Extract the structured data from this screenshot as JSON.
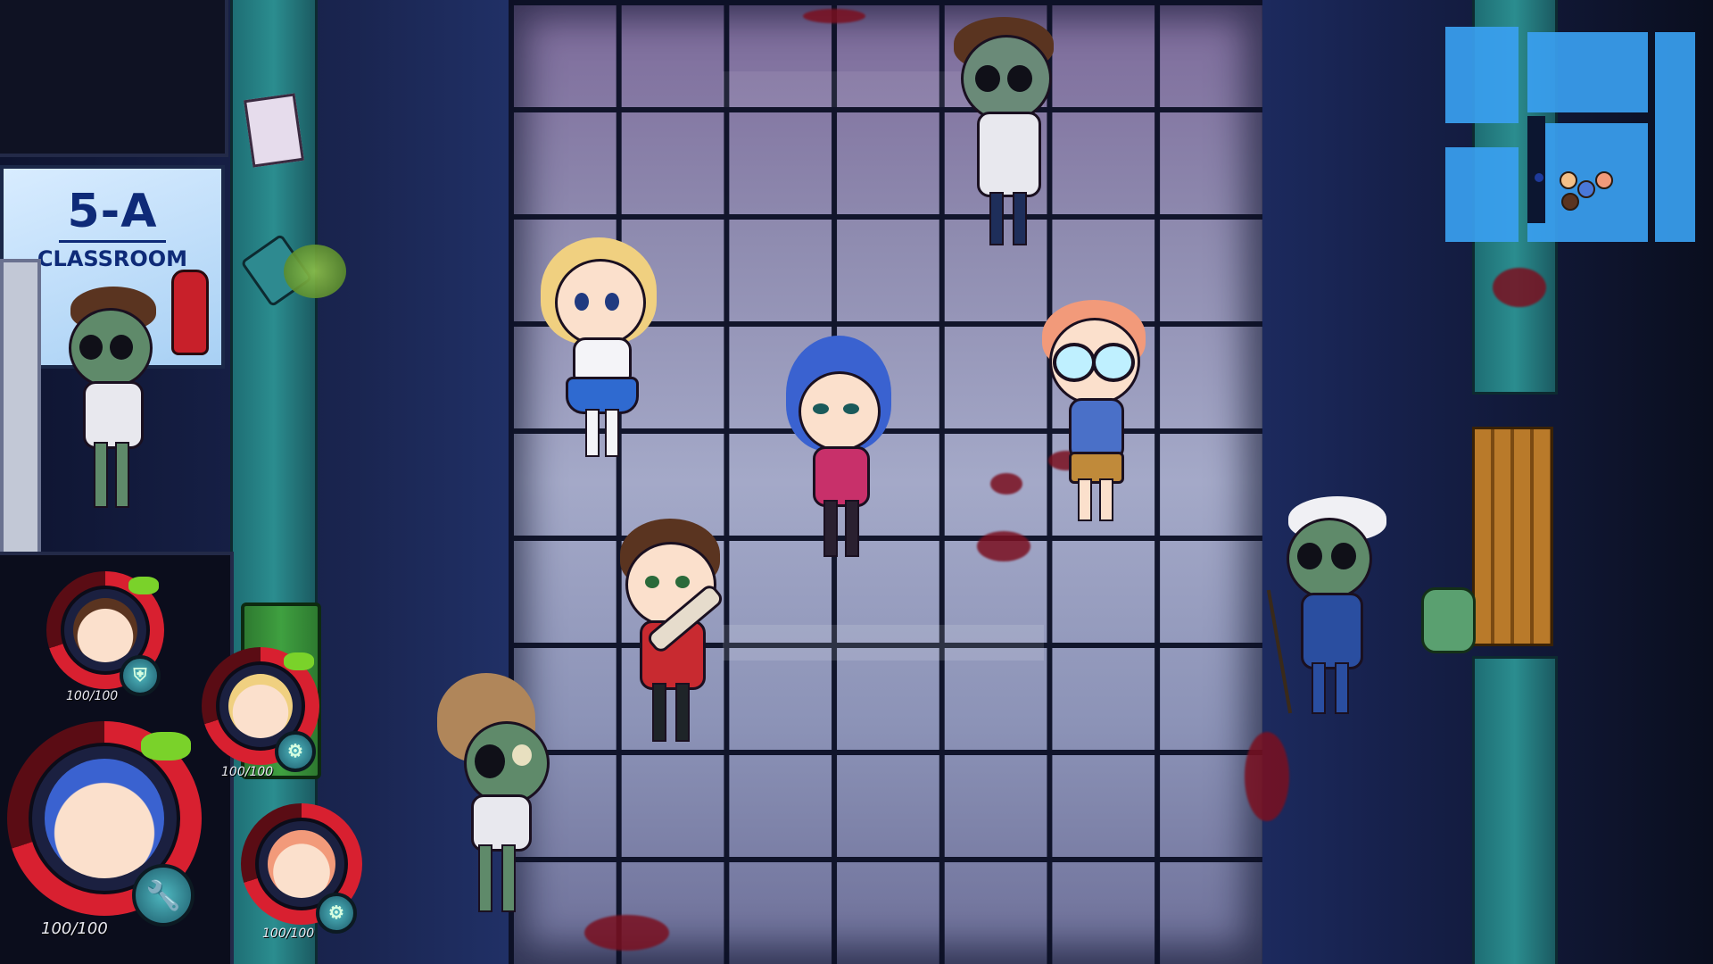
{
  "classroom_sign": {
    "number": "5-A",
    "label": "CLASSROOM"
  },
  "party": [
    {
      "name": "brown-hair-boy",
      "hp_text": "100/100",
      "hp_fraction": 1.0,
      "ability_icon": "shield-icon"
    },
    {
      "name": "blonde-girl",
      "hp_text": "100/100",
      "hp_fraction": 1.0,
      "ability_icon": "gear-icon"
    },
    {
      "name": "blue-hair-girl",
      "hp_text": "100/100",
      "hp_fraction": 1.0,
      "ability_icon": "wrench-icon",
      "active": true
    },
    {
      "name": "glasses-boy",
      "hp_text": "100/100",
      "hp_fraction": 1.0,
      "ability_icon": "gear-icon"
    }
  ],
  "colors": {
    "hp_ring": "#d82030",
    "slime": "#7ad22a",
    "minimap": "#3aa0f0",
    "floor_grid": "#0b0f24"
  }
}
